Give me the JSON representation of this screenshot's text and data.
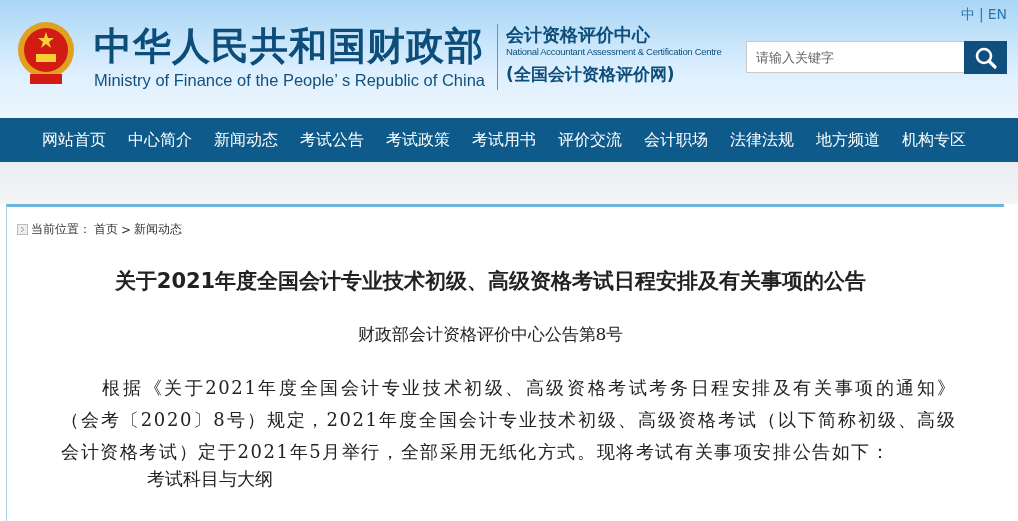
{
  "header": {
    "title": "中华人民共和国财政部",
    "subtitle": "Ministry of Finance of the People’ s Republic of China",
    "center_name": "会计资格评价中心",
    "center_en": "National Accountant Assessment & Certification Centre",
    "site_name": "(全国会计资格评价网)",
    "languages": [
      "中",
      "EN"
    ],
    "language_separator": "|",
    "search": {
      "placeholder": "请输入关键字"
    }
  },
  "nav": [
    "网站首页",
    "中心简介",
    "新闻动态",
    "考试公告",
    "考试政策",
    "考试用书",
    "评价交流",
    "会计职场",
    "法律法规",
    "地方频道",
    "机构专区"
  ],
  "breadcrumb": {
    "label": "当前位置：",
    "items": [
      "首页",
      "新闻动态"
    ],
    "separator": ">"
  },
  "article": {
    "title": "关于2021年度全国会计专业技术初级、高级资格考试日程安排及有关事项的公告",
    "subtitle": "财政部会计资格评价中心公告第8号",
    "paragraphs": [
      "根据《关于2021年度全国会计专业技术初级、高级资格考试考务日程安排及有关事项的通知》（会考〔2020〕8号）规定，2021年度全国会计专业技术初级、高级资格考试（以下简称初级、高级会计资格考试）定于2021年5月举行，全部采用无纸化方式。现将考试有关事项安排公告如下："
    ],
    "section_heading": "考试科目与大纲"
  }
}
